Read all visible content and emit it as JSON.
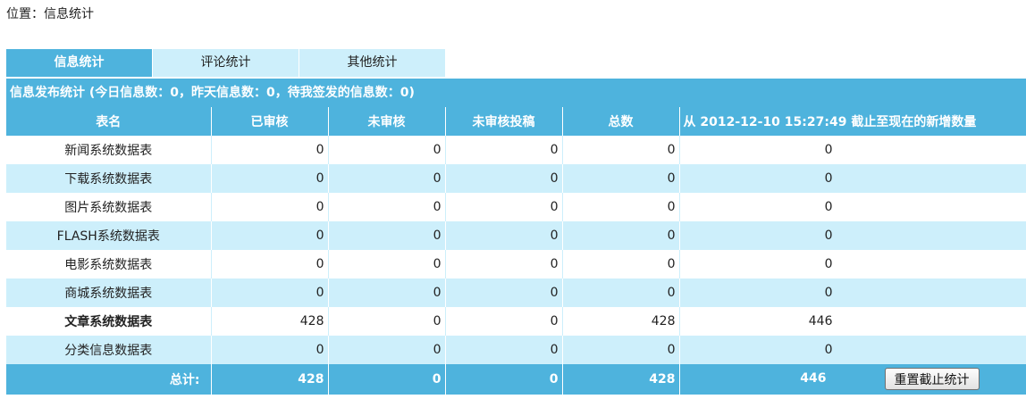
{
  "breadcrumb": "位置：信息统计",
  "tabs": [
    {
      "label": "信息统计",
      "active": true
    },
    {
      "label": "评论统计",
      "active": false
    },
    {
      "label": "其他统计",
      "active": false
    }
  ],
  "panel": {
    "title": "信息发布统计 (今日信息数：0，昨天信息数：0，待我签发的信息数：0)"
  },
  "table": {
    "columns": [
      "表名",
      "已审核",
      "未审核",
      "未审核投稿",
      "总数",
      "从 2012-12-10 15:27:49 截止至现在的新增数量"
    ],
    "rows": [
      {
        "name": "新闻系统数据表",
        "approved": "0",
        "unapproved": "0",
        "pending_submissions": "0",
        "total": "0",
        "new_since": "0"
      },
      {
        "name": "下载系统数据表",
        "approved": "0",
        "unapproved": "0",
        "pending_submissions": "0",
        "total": "0",
        "new_since": "0"
      },
      {
        "name": "图片系统数据表",
        "approved": "0",
        "unapproved": "0",
        "pending_submissions": "0",
        "total": "0",
        "new_since": "0"
      },
      {
        "name": "FLASH系统数据表",
        "approved": "0",
        "unapproved": "0",
        "pending_submissions": "0",
        "total": "0",
        "new_since": "0"
      },
      {
        "name": "电影系统数据表",
        "approved": "0",
        "unapproved": "0",
        "pending_submissions": "0",
        "total": "0",
        "new_since": "0"
      },
      {
        "name": "商城系统数据表",
        "approved": "0",
        "unapproved": "0",
        "pending_submissions": "0",
        "total": "0",
        "new_since": "0"
      },
      {
        "name": "文章系统数据表",
        "approved": "428",
        "unapproved": "0",
        "pending_submissions": "0",
        "total": "428",
        "new_since": "446"
      },
      {
        "name": "分类信息数据表",
        "approved": "0",
        "unapproved": "0",
        "pending_submissions": "0",
        "total": "0",
        "new_since": "0"
      }
    ],
    "totals": {
      "label": "总计:",
      "approved": "428",
      "unapproved": "0",
      "pending_submissions": "0",
      "total": "428",
      "new_since": "446"
    },
    "reset_button_label": "重置截止统计"
  },
  "colors": {
    "header_blue": "#4eb3dd",
    "stripe_light": "#cdeffb"
  }
}
